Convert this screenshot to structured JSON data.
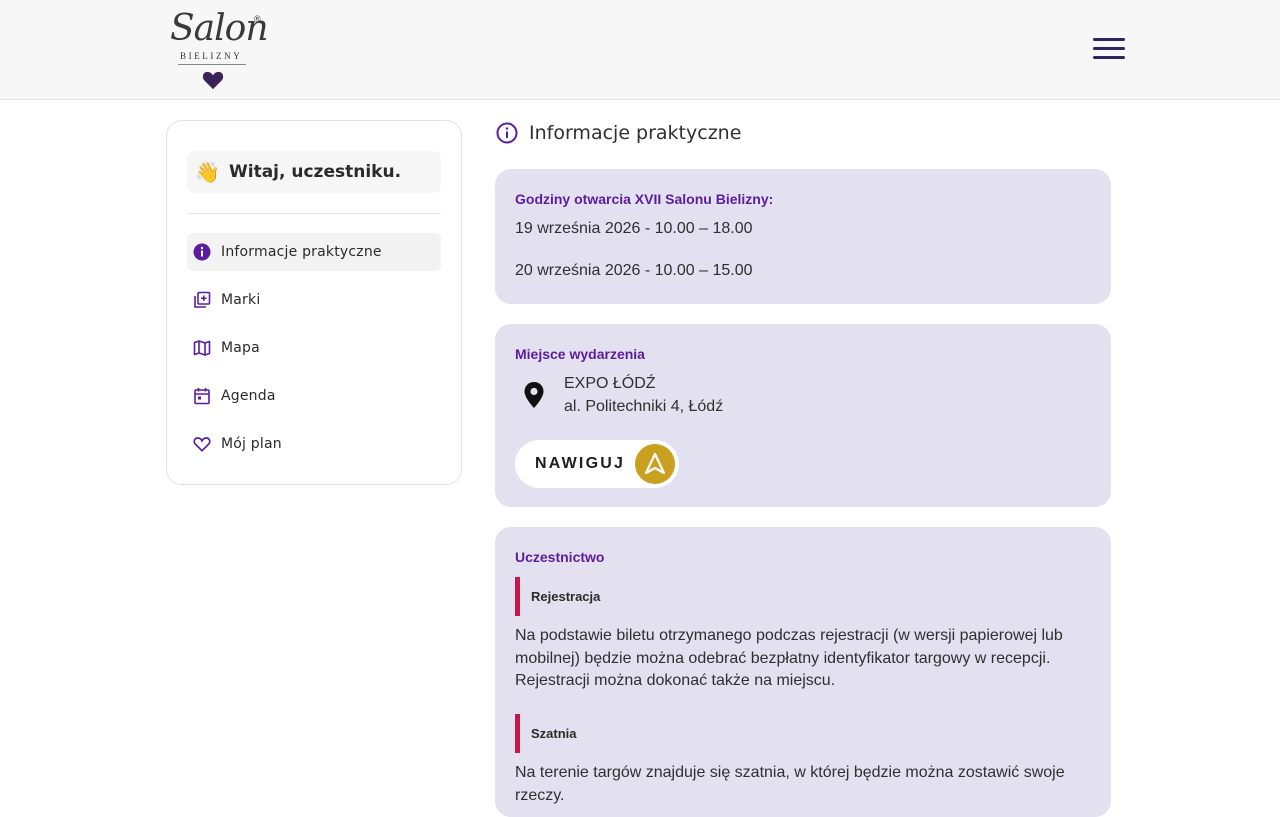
{
  "header": {
    "logo": {
      "script_text": "Salon",
      "sub_text": "BIELIZNY",
      "reg_mark": "®"
    },
    "menu_icon": "hamburger-menu-icon"
  },
  "sidebar": {
    "welcome_emoji": "👋",
    "welcome_text": "Witaj, uczestniku.",
    "items": [
      {
        "label": "Informacje praktyczne",
        "icon": "info-icon",
        "active": true
      },
      {
        "label": "Marki",
        "icon": "brands-icon",
        "active": false
      },
      {
        "label": "Mapa",
        "icon": "map-icon",
        "active": false
      },
      {
        "label": "Agenda",
        "icon": "calendar-icon",
        "active": false
      },
      {
        "label": "Mój plan",
        "icon": "heart-icon",
        "active": false
      }
    ]
  },
  "main": {
    "title": "Informacje praktyczne",
    "hours": {
      "heading": "Godziny otwarcia XVII Salonu Bielizny:",
      "line1": "19 września 2026 - 10.00 – 18.00",
      "line2": "20 września 2026 - 10.00 – 15.00"
    },
    "venue": {
      "heading": "Miejsce wydarzenia",
      "name": "EXPO ŁÓDŹ",
      "address": "al. Politechniki 4, Łódź",
      "navigate_label": "NAWIGUJ"
    },
    "participation": {
      "heading": "Uczestnictwo",
      "sections": [
        {
          "title": "Rejestracja",
          "text": "Na podstawie biletu otrzymanego podczas rejestracji (w wersji papierowej lub mobilnej) będzie można odebrać bezpłatny identyfikator targowy w recepcji. Rejestracji można dokonać także na miejscu."
        },
        {
          "title": "Szatnia",
          "text": "Na terenie targów znajduje się szatnia, w której będzie można zostawić swoje rzeczy."
        }
      ]
    }
  },
  "colors": {
    "accent_purple": "#5b1d9e",
    "card_bg": "#e3e0ef",
    "section_bar": "#c2184d",
    "navigate_gold": "#c9a020",
    "menu_navy": "#2d2460"
  }
}
